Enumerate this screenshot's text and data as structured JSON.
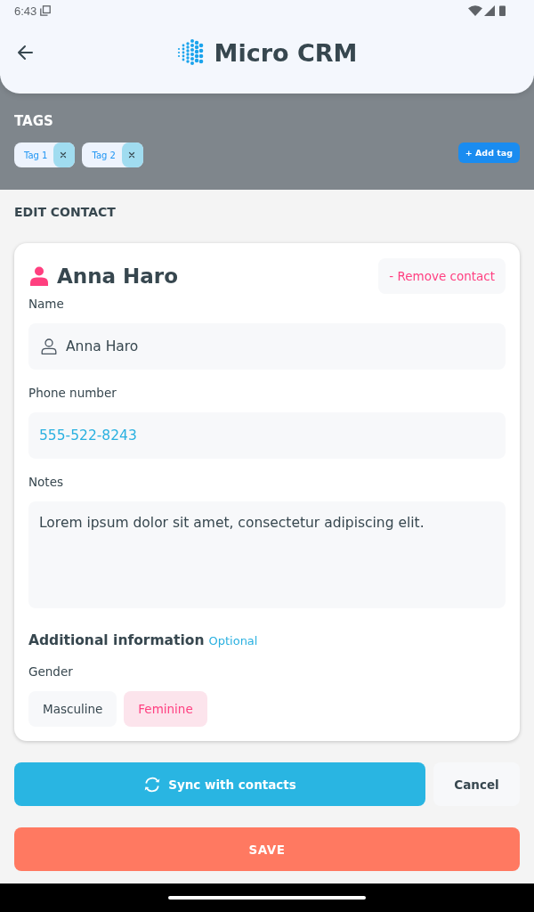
{
  "status_bar": {
    "time": "6:43"
  },
  "header": {
    "title": "Micro CRM"
  },
  "tags": {
    "title": "TAGS",
    "items": [
      {
        "label": "Tag 1"
      },
      {
        "label": "Tag 2"
      }
    ],
    "add_button": "+ Add tag"
  },
  "edit_contact": {
    "section_title": "EDIT CONTACT",
    "contact_name": "Anna Haro",
    "remove_button": "- Remove contact",
    "fields": [
      {
        "kind": "name",
        "label": "Name",
        "value": "Anna Haro"
      },
      {
        "kind": "phone",
        "label": "Phone number",
        "value": "555-522-8243"
      },
      {
        "kind": "notes",
        "label": "Notes",
        "value": "Lorem ipsum dolor sit amet, consectetur adipiscing elit."
      }
    ],
    "additional": {
      "title": "Additional information",
      "badge": "Optional"
    },
    "gender": {
      "label": "Gender",
      "options": [
        {
          "label": "Masculine",
          "selected": false
        },
        {
          "label": "Feminine",
          "selected": true
        }
      ]
    }
  },
  "actions": {
    "sync_button": "Sync with contacts",
    "cancel_button": "Cancel",
    "save_button": "SAVE"
  }
}
